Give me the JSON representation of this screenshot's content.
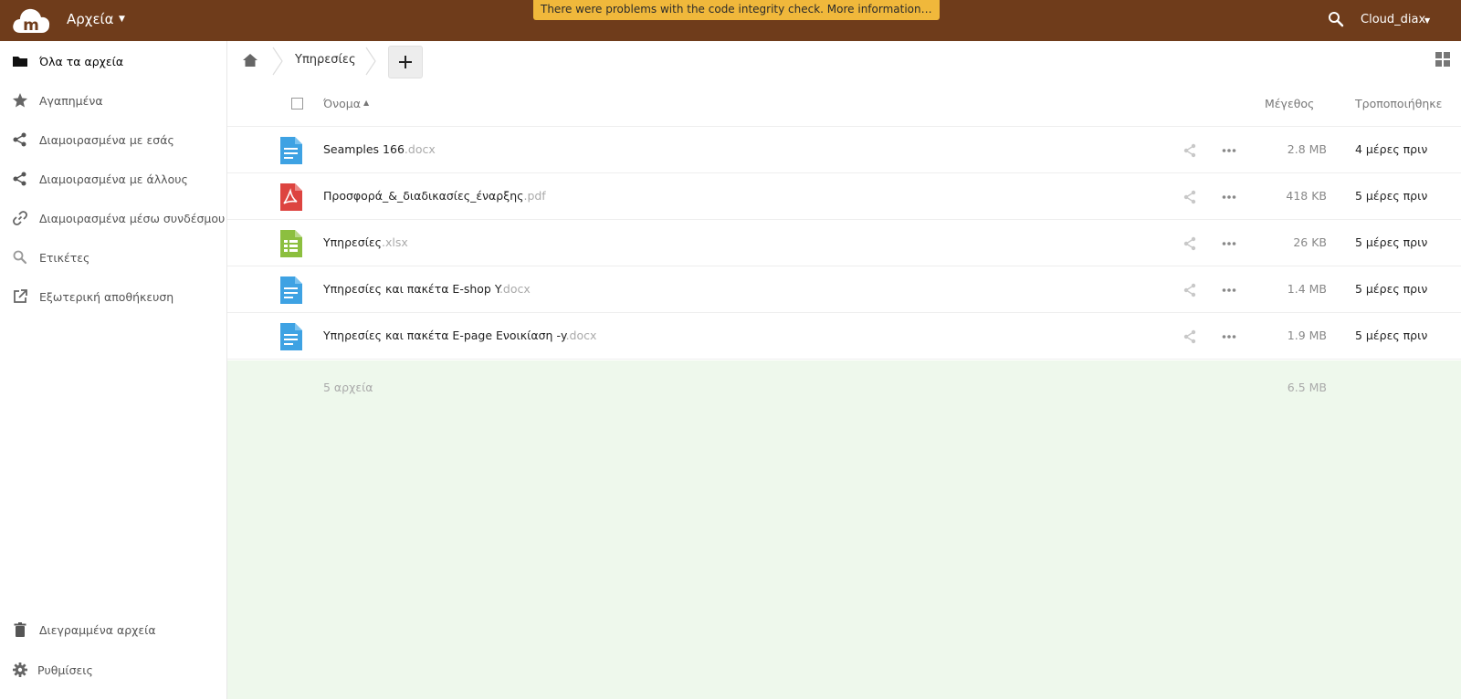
{
  "header": {
    "app_name": "Αρχεία",
    "warning": "There were problems with the code integrity check. More information…",
    "user": "Cloud_diax",
    "brand_color": "#6f3c1b",
    "warning_color": "#f0b83b"
  },
  "sidebar": {
    "items": [
      {
        "label": "Όλα τα αρχεία",
        "icon": "folder-icon"
      },
      {
        "label": "Αγαπημένα",
        "icon": "star-icon"
      },
      {
        "label": "Διαμοιρασμένα με εσάς",
        "icon": "share-icon"
      },
      {
        "label": "Διαμοιρασμένα με άλλους",
        "icon": "share-icon"
      },
      {
        "label": "Διαμοιρασμένα μέσω συνδέσμου",
        "icon": "link-icon"
      },
      {
        "label": "Ετικέτες",
        "icon": "tag-search-icon"
      },
      {
        "label": "Εξωτερική αποθήκευση",
        "icon": "external-icon"
      }
    ],
    "trash_label": "Διεγραμμένα αρχεία",
    "settings_label": "Ρυθμίσεις"
  },
  "breadcrumb": {
    "current": "Υπηρεσίες",
    "add_label": "+"
  },
  "table": {
    "col_name": "Όνομα",
    "col_size": "Μέγεθος",
    "col_modified": "Τροποποιήθηκε",
    "files": [
      {
        "name": "Seamples 166",
        "ext": ".docx",
        "type": "doc",
        "size": "2.8 MB",
        "modified": "4 μέρες πριν"
      },
      {
        "name": "Προσφορά_&_διαδικασίες_έναρξης",
        "ext": ".pdf",
        "type": "pdf",
        "size": "418 KB",
        "modified": "5 μέρες πριν"
      },
      {
        "name": "Υπηρεσίες",
        "ext": ".xlsx",
        "type": "sheet",
        "size": "26 KB",
        "modified": "5 μέρες πριν"
      },
      {
        "name": "Υπηρεσίες και πακέτα E-shop Y",
        "ext": ".docx",
        "type": "doc",
        "size": "1.4 MB",
        "modified": "5 μέρες πριν"
      },
      {
        "name": "Υπηρεσίες και πακέτα E-page Ενοικίαση -y",
        "ext": ".docx",
        "type": "doc",
        "size": "1.9 MB",
        "modified": "5 μέρες πριν"
      }
    ],
    "summary_count": "5 αρχεία",
    "summary_size": "6.5 MB"
  }
}
